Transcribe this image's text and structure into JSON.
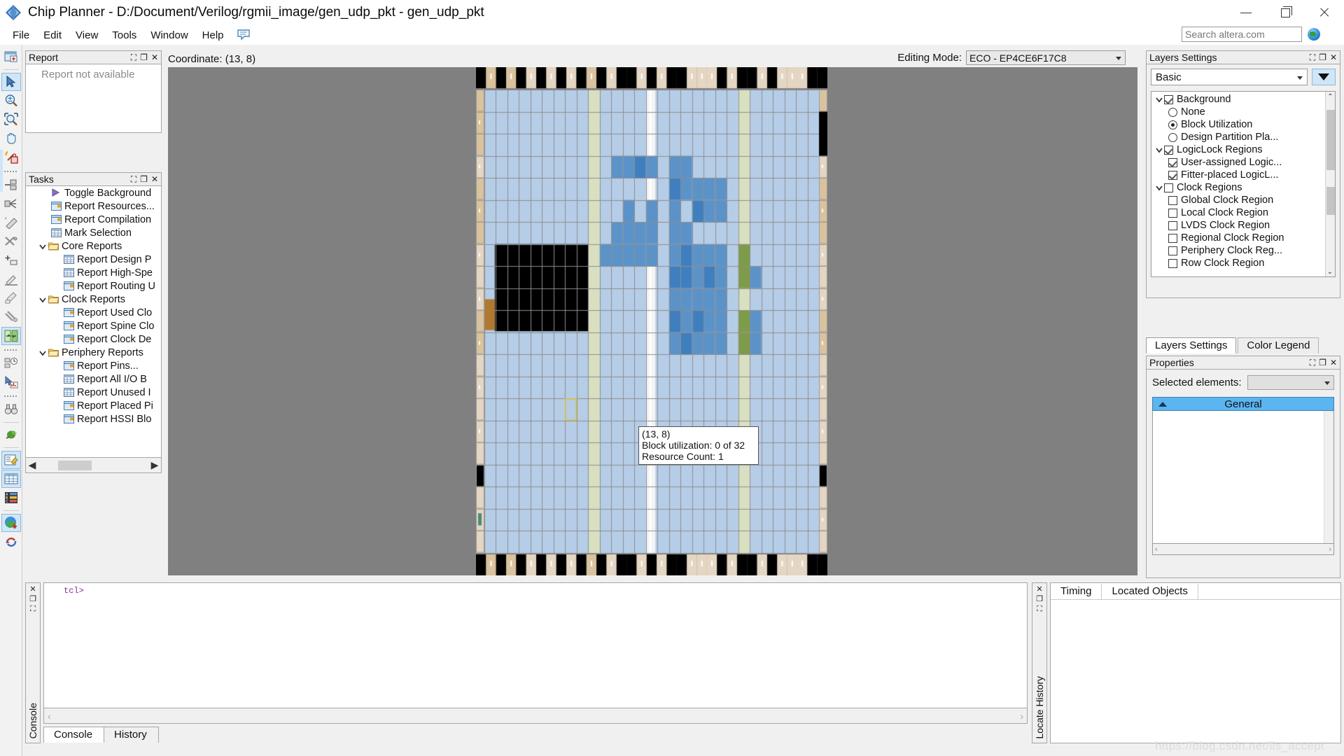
{
  "window": {
    "title": "Chip Planner - D:/Document/Verilog/rgmii_image/gen_udp_pkt - gen_udp_pkt",
    "app_icon": "quartus-diamond-icon",
    "minimize": "—",
    "maximize": "❐",
    "close": "✕"
  },
  "menu": {
    "items": [
      {
        "label": "File"
      },
      {
        "label": "Edit"
      },
      {
        "label": "View"
      },
      {
        "label": "Tools"
      },
      {
        "label": "Window"
      },
      {
        "label": "Help"
      }
    ],
    "bubble_icon": "speech-bubble-icon"
  },
  "search": {
    "placeholder": "Search altera.com",
    "value": "",
    "globe_icon": "globe-icon"
  },
  "left_toolbar": {
    "tools": [
      {
        "name": "new-chip-view",
        "icon": "window-plus-icon",
        "selected": false
      },
      {
        "name": "select-tool",
        "icon": "cursor-arrow-icon",
        "selected": true
      },
      {
        "name": "zoom-tool",
        "icon": "magnifier-plusminus-icon",
        "selected": false
      },
      {
        "name": "zoom-region-tool",
        "icon": "magnifier-region-icon",
        "selected": false
      },
      {
        "name": "pan-tool",
        "icon": "hand-icon",
        "selected": false
      },
      {
        "name": "highlight-routing-tool",
        "icon": "wand-lock-icon",
        "selected": false
      },
      {
        "name": "create-node",
        "icon": "node-in-icon",
        "selected": false
      },
      {
        "name": "fan-out",
        "icon": "fanout-icon",
        "selected": false
      },
      {
        "name": "delete-path",
        "icon": "eraser-icon",
        "selected": false
      },
      {
        "name": "cut-connection",
        "icon": "scissors-icon",
        "selected": false
      },
      {
        "name": "add-item",
        "icon": "plus-box-icon",
        "selected": false
      },
      {
        "name": "pencil-tool",
        "icon": "pencil-icon",
        "selected": false
      },
      {
        "name": "eraser-tool",
        "icon": "eraser2-icon",
        "selected": false
      },
      {
        "name": "repair-tool",
        "icon": "wrench-icon",
        "selected": false
      },
      {
        "name": "swap-blocks",
        "icon": "swap-arrows-icon",
        "selected": true
      },
      {
        "name": "timing-report",
        "icon": "clock-blocks-icon",
        "selected": false
      },
      {
        "name": "chart-tool",
        "icon": "cursor-chart-icon",
        "selected": false
      },
      {
        "name": "find-tool",
        "icon": "binoculars-icon",
        "selected": false
      },
      {
        "name": "bird-tool",
        "icon": "parrot-icon",
        "selected": false
      },
      {
        "name": "properties-tool",
        "icon": "properties-icon",
        "selected": true
      },
      {
        "name": "table-tool",
        "icon": "grid-table-icon",
        "selected": true
      },
      {
        "name": "legend-tool",
        "icon": "color-legend-icon",
        "selected": false
      },
      {
        "name": "globe-download",
        "icon": "globe-down-icon",
        "selected": true
      },
      {
        "name": "refresh",
        "icon": "refresh-arrows-icon",
        "selected": false
      }
    ]
  },
  "report_panel": {
    "title": "Report",
    "pin_icon": "pin-icon",
    "float_icon": "restore-icon",
    "close_icon": "close-icon",
    "empty_text": "Report not available"
  },
  "tasks_panel": {
    "title": "Tasks",
    "pin_icon": "pin-icon",
    "float_icon": "restore-icon",
    "close_icon": "close-icon",
    "items": [
      {
        "label": "Toggle Background",
        "icon": "play-icon",
        "indent": 1,
        "expander": "none"
      },
      {
        "label": "Report Resources...",
        "icon": "window-icon",
        "indent": 1,
        "expander": "none"
      },
      {
        "label": "Report Compilation",
        "icon": "window-icon",
        "indent": 1,
        "expander": "none"
      },
      {
        "label": "Mark Selection",
        "icon": "table-icon",
        "indent": 1,
        "expander": "none"
      },
      {
        "label": "Core Reports",
        "icon": "folder-icon",
        "indent": 0,
        "expander": "open"
      },
      {
        "label": "Report Design P",
        "icon": "table-icon",
        "indent": 2,
        "expander": "none"
      },
      {
        "label": "Report High-Spe",
        "icon": "table-icon",
        "indent": 2,
        "expander": "none"
      },
      {
        "label": "Report Routing U",
        "icon": "window-icon",
        "indent": 2,
        "expander": "none"
      },
      {
        "label": "Clock Reports",
        "icon": "folder-icon",
        "indent": 0,
        "expander": "open"
      },
      {
        "label": "Report Used Clo",
        "icon": "window-icon",
        "indent": 2,
        "expander": "none"
      },
      {
        "label": "Report Spine Clo",
        "icon": "window-icon",
        "indent": 2,
        "expander": "none"
      },
      {
        "label": "Report Clock De",
        "icon": "window-icon",
        "indent": 2,
        "expander": "none"
      },
      {
        "label": "Periphery Reports",
        "icon": "folder-icon",
        "indent": 0,
        "expander": "open"
      },
      {
        "label": "Report Pins...",
        "icon": "window-icon",
        "indent": 2,
        "expander": "none"
      },
      {
        "label": "Report All I/O B",
        "icon": "table-icon",
        "indent": 2,
        "expander": "none"
      },
      {
        "label": "Report Unused I",
        "icon": "table-icon",
        "indent": 2,
        "expander": "none"
      },
      {
        "label": "Report Placed Pi",
        "icon": "window-icon",
        "indent": 2,
        "expander": "none"
      },
      {
        "label": "Report HSSI Blo",
        "icon": "window-icon",
        "indent": 2,
        "expander": "none"
      }
    ],
    "scroll_left_icon": "◀",
    "scroll_right_icon": "▶"
  },
  "chipview": {
    "coordinate_label": "Coordinate: (13, 8)",
    "editing_mode_label": "Editing Mode:",
    "editing_mode_value": "ECO - EP4CE6F17C8",
    "background_color": "#808080",
    "tooltip": {
      "coord": "(13, 8)",
      "block_utilization": "Block utilization: 0 of 32",
      "resource_count": "Resource Count: 1"
    }
  },
  "layers_panel": {
    "title": "Layers Settings",
    "pin_icon": "pin-icon",
    "float_icon": "restore-icon",
    "close_icon": "close-icon",
    "mode_value": "Basic",
    "expand_button_icon": "chevron-down-big-icon",
    "tree": [
      {
        "label": "Background",
        "type": "check",
        "checked": true,
        "expander": "open",
        "indent": 0
      },
      {
        "label": "None",
        "type": "radio",
        "checked": false,
        "expander": "none",
        "indent": 1
      },
      {
        "label": "Block Utilization",
        "type": "radio",
        "checked": true,
        "expander": "none",
        "indent": 1
      },
      {
        "label": "Design Partition Pla...",
        "type": "radio",
        "checked": false,
        "expander": "none",
        "indent": 1
      },
      {
        "label": "LogicLock Regions",
        "type": "check",
        "checked": true,
        "expander": "open",
        "indent": 0
      },
      {
        "label": "User-assigned Logic...",
        "type": "check",
        "checked": true,
        "expander": "none",
        "indent": 1
      },
      {
        "label": "Fitter-placed LogicL...",
        "type": "check",
        "checked": true,
        "expander": "none",
        "indent": 1
      },
      {
        "label": "Clock Regions",
        "type": "check",
        "checked": false,
        "expander": "open",
        "indent": 0
      },
      {
        "label": "Global Clock Region",
        "type": "check",
        "checked": false,
        "expander": "none",
        "indent": 1
      },
      {
        "label": "Local Clock Region",
        "type": "check",
        "checked": false,
        "expander": "none",
        "indent": 1
      },
      {
        "label": "LVDS Clock Region",
        "type": "check",
        "checked": false,
        "expander": "none",
        "indent": 1
      },
      {
        "label": "Regional Clock Region",
        "type": "check",
        "checked": false,
        "expander": "none",
        "indent": 1
      },
      {
        "label": "Periphery Clock Reg...",
        "type": "check",
        "checked": false,
        "expander": "none",
        "indent": 1
      },
      {
        "label": "Row Clock Region",
        "type": "check",
        "checked": false,
        "expander": "none",
        "indent": 1
      }
    ],
    "scroll_up_icon": "⌃",
    "scroll_down_icon": "⌄"
  },
  "right_tabs": [
    {
      "label": "Layers Settings",
      "active": true
    },
    {
      "label": "Color Legend",
      "active": false
    }
  ],
  "properties_panel": {
    "title": "Properties",
    "pin_icon": "pin-icon",
    "float_icon": "restore-icon",
    "close_icon": "close-icon",
    "selected_elements_label": "Selected elements:",
    "selected_elements_value": "",
    "general_section": "General",
    "scroll_left_icon": "‹",
    "scroll_right_icon": "›"
  },
  "console_panel": {
    "side_label": "Console",
    "close_icon": "close-icon",
    "float_icon": "restore-icon",
    "pin_icon": "pin-icon",
    "prompt": "tcl>",
    "tabs": [
      {
        "label": "Console",
        "active": true
      },
      {
        "label": "History",
        "active": false
      }
    ]
  },
  "locate_panel": {
    "side_label": "Locate History",
    "close_icon": "close-icon",
    "float_icon": "restore-icon",
    "pin_icon": "pin-icon",
    "tabs": [
      {
        "label": "Timing",
        "active": true
      },
      {
        "label": "Located Objects",
        "active": false
      }
    ]
  },
  "watermark": "https://blog.csdn.net/lis_accept",
  "colors": {
    "accent": "#5bb5f0",
    "selected_tool": "#cfe6f8",
    "die_light": "#b6cde8",
    "die_mid": "#6d9ed1",
    "die_dark": "#3f7fc0",
    "die_pad": "#d9c29d",
    "die_pad_light": "#e4d6c2",
    "die_black": "#000000",
    "die_green": "#7e9b4a",
    "die_palegreen": "#d9e0c2",
    "die_white": "#f4f4f4"
  },
  "chip_data": {
    "type": "heatmap",
    "description": "FPGA floorplan block utilization map",
    "cols": 29,
    "rows": 21,
    "legend": "Block Utilization",
    "hover_cell": [
      13,
      8
    ]
  }
}
